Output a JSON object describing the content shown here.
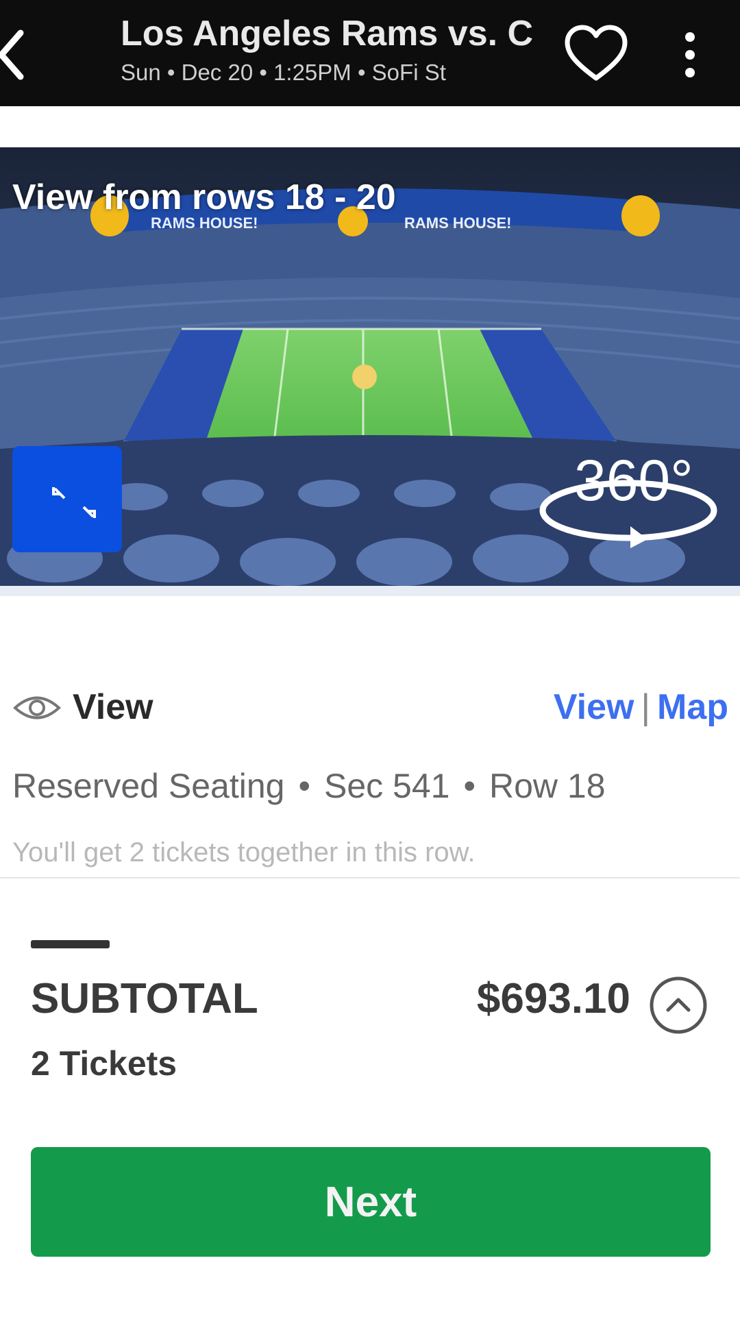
{
  "header": {
    "title": "Los Angeles Rams vs. C",
    "subtitle": "Sun • Dec 20 • 1:25PM • SoFi St",
    "icons": {
      "back": "back-arrow-icon",
      "favorite": "heart-icon",
      "more": "more-vertical-icon"
    }
  },
  "hero": {
    "caption": "View from rows 18 - 20",
    "banner_left": "RAMS HOUSE!",
    "banner_right": "RAMS HOUSE!",
    "badge_360": "360°",
    "icons": {
      "expand": "expand-icon",
      "view360": "rotate-360-icon"
    }
  },
  "info": {
    "view_label": "View",
    "view_link": "View",
    "separator": "|",
    "map_link": "Map",
    "seating_type": "Reserved Seating",
    "section": "Sec 541",
    "row": "Row 18",
    "dot": "•",
    "note": "You'll get 2 tickets together in this row."
  },
  "subtotal": {
    "label": "SUBTOTAL",
    "amount": "$693.10",
    "tickets": "2 Tickets"
  },
  "actions": {
    "next_label": "Next"
  },
  "colors": {
    "header_bg": "#0d0d0d",
    "link": "#3d6ff0",
    "primary_button": "#149a4b",
    "expand_button": "#0b4fe0"
  }
}
